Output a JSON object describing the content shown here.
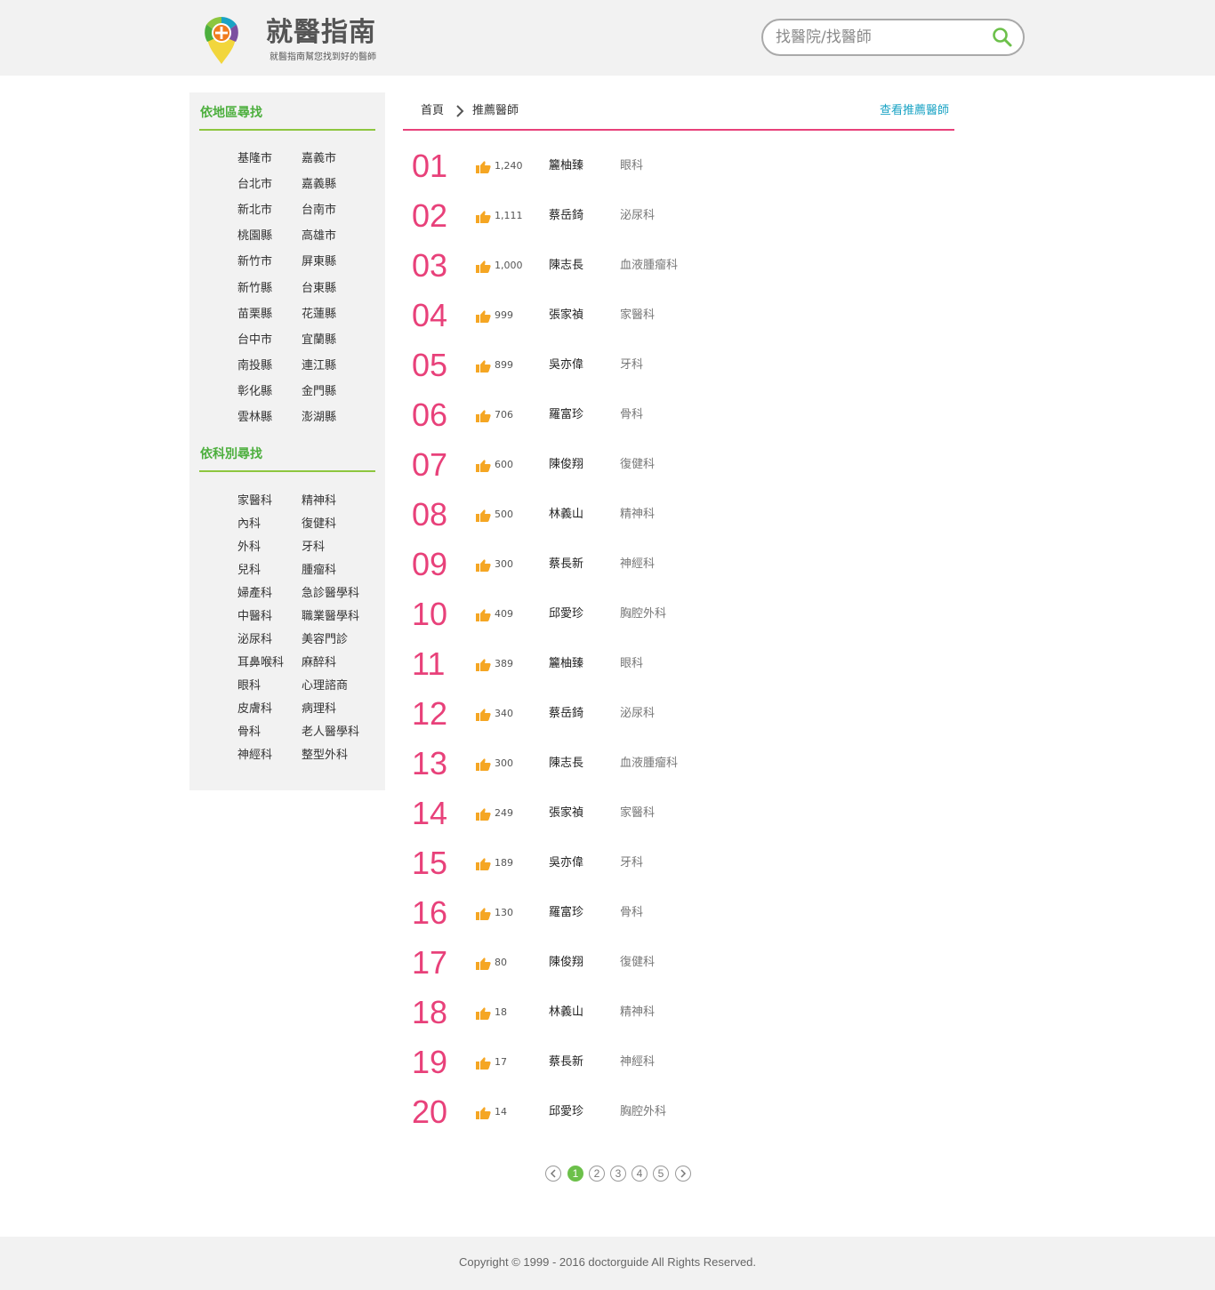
{
  "header": {
    "site_title": "就醫指南",
    "slogan": "就醫指南幫您找到好的醫師",
    "search_placeholder": "找醫院/找醫師"
  },
  "sidebar": {
    "region_heading": "依地區尋找",
    "regions": [
      "基隆市",
      "嘉義市",
      "台北市",
      "嘉義縣",
      "新北市",
      "台南市",
      "桃園縣",
      "高雄市",
      "新竹市",
      "屏東縣",
      "新竹縣",
      "台東縣",
      "苗栗縣",
      "花蓮縣",
      "台中市",
      "宜蘭縣",
      "南投縣",
      "連江縣",
      "彰化縣",
      "金門縣",
      "雲林縣",
      "澎湖縣"
    ],
    "department_heading": "依科別尋找",
    "departments": [
      "家醫科",
      "精神科",
      "內科",
      "復健科",
      "外科",
      "牙科",
      "兒科",
      "腫瘤科",
      "婦產科",
      "急診醫學科",
      "中醫科",
      "職業醫學科",
      "泌尿科",
      "美容門診",
      "耳鼻喉科",
      "麻醉科",
      "眼科",
      "心理諮商",
      "皮膚科",
      "病理科",
      "骨科",
      "老人醫學科",
      "神經科",
      "整型外科"
    ]
  },
  "breadcrumb": {
    "home": "首頁",
    "current": "推薦醫師"
  },
  "view_link": "查看推薦醫師",
  "doctors": [
    {
      "rank": "01",
      "votes": "1,240",
      "name": "籭柚臻",
      "specialty": "眼科"
    },
    {
      "rank": "02",
      "votes": "1,111",
      "name": "蔡岳錡",
      "specialty": "泌尿科"
    },
    {
      "rank": "03",
      "votes": "1,000",
      "name": "陳志長",
      "specialty": "血液腫瘤科"
    },
    {
      "rank": "04",
      "votes": "999",
      "name": "張家禎",
      "specialty": "家醫科"
    },
    {
      "rank": "05",
      "votes": "899",
      "name": "吳亦偉",
      "specialty": "牙科"
    },
    {
      "rank": "06",
      "votes": "706",
      "name": "羅富珍",
      "specialty": "骨科"
    },
    {
      "rank": "07",
      "votes": "600",
      "name": "陳俊翔",
      "specialty": "復健科"
    },
    {
      "rank": "08",
      "votes": "500",
      "name": "林義山",
      "specialty": "精神科"
    },
    {
      "rank": "09",
      "votes": "300",
      "name": "蔡長新",
      "specialty": "神經科"
    },
    {
      "rank": "10",
      "votes": "409",
      "name": "邱愛珍",
      "specialty": "胸腔外科"
    },
    {
      "rank": "11",
      "votes": "389",
      "name": "籭柚臻",
      "specialty": "眼科"
    },
    {
      "rank": "12",
      "votes": "340",
      "name": "蔡岳錡",
      "specialty": "泌尿科"
    },
    {
      "rank": "13",
      "votes": "300",
      "name": "陳志長",
      "specialty": "血液腫瘤科"
    },
    {
      "rank": "14",
      "votes": "249",
      "name": "張家禎",
      "specialty": "家醫科"
    },
    {
      "rank": "15",
      "votes": "189",
      "name": "吳亦偉",
      "specialty": "牙科"
    },
    {
      "rank": "16",
      "votes": "130",
      "name": "羅富珍",
      "specialty": "骨科"
    },
    {
      "rank": "17",
      "votes": "80",
      "name": "陳俊翔",
      "specialty": "復健科"
    },
    {
      "rank": "18",
      "votes": "18",
      "name": "林義山",
      "specialty": "精神科"
    },
    {
      "rank": "19",
      "votes": "17",
      "name": "蔡長新",
      "specialty": "神經科"
    },
    {
      "rank": "20",
      "votes": "14",
      "name": "邱愛珍",
      "specialty": "胸腔外科"
    }
  ],
  "pagination": {
    "pages": [
      "1",
      "2",
      "3",
      "4",
      "5"
    ],
    "current": "1"
  },
  "footer": {
    "copyright": "Copyright © 1999 - 2016 doctorguide All Rights Reserved."
  },
  "colors": {
    "accent_pink": "#e8417a",
    "accent_green": "#4caf3d",
    "link_blue": "#1aa3c4",
    "thumb_orange": "#f5a623"
  }
}
